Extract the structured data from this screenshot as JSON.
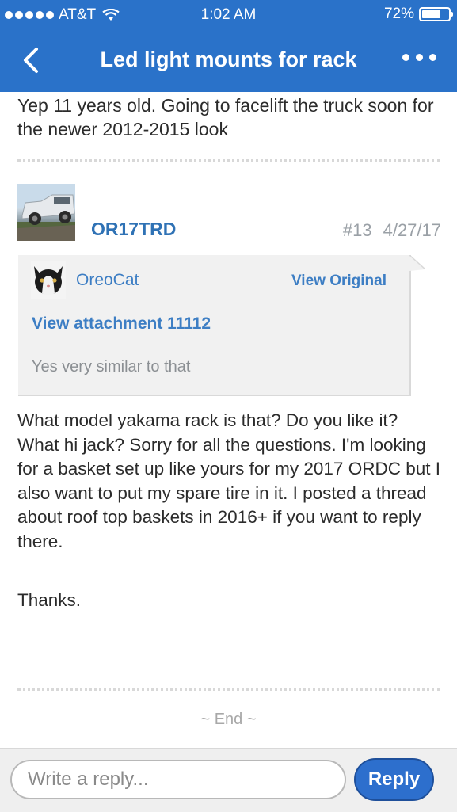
{
  "status_bar": {
    "carrier": "AT&T",
    "time": "1:02 AM",
    "battery_percent": "72%",
    "battery_level": 0.72
  },
  "nav": {
    "title": "Led light mounts for rack",
    "back_icon": "chevron-left-icon",
    "more_icon": "more-dots-icon"
  },
  "previous_post": {
    "text": "Yep 11 years old. Going to facelift the truck soon for the newer 2012-2015 look"
  },
  "post": {
    "author": "OR17TRD",
    "number": "#13",
    "date": "4/27/17",
    "quote": {
      "user": "OreoCat",
      "view_original": "View Original",
      "attachment": "View attachment 11112",
      "text": "Yes very similar to that"
    },
    "body": "What model yakama rack is that? Do you like it? What hi jack? Sorry for all the questions. I'm looking for a basket set up like yours for my 2017 ORDC but I also want to put my spare tire in it. I posted a thread about roof top baskets in 2016+ if you want to reply there.",
    "signoff": "Thanks."
  },
  "end_marker": "~ End ~",
  "reply_bar": {
    "placeholder": "Write a reply...",
    "button": "Reply"
  },
  "colors": {
    "header_bg": "#2a72c9",
    "link": "#2f72b5",
    "reply_button": "#2d6fcd"
  }
}
